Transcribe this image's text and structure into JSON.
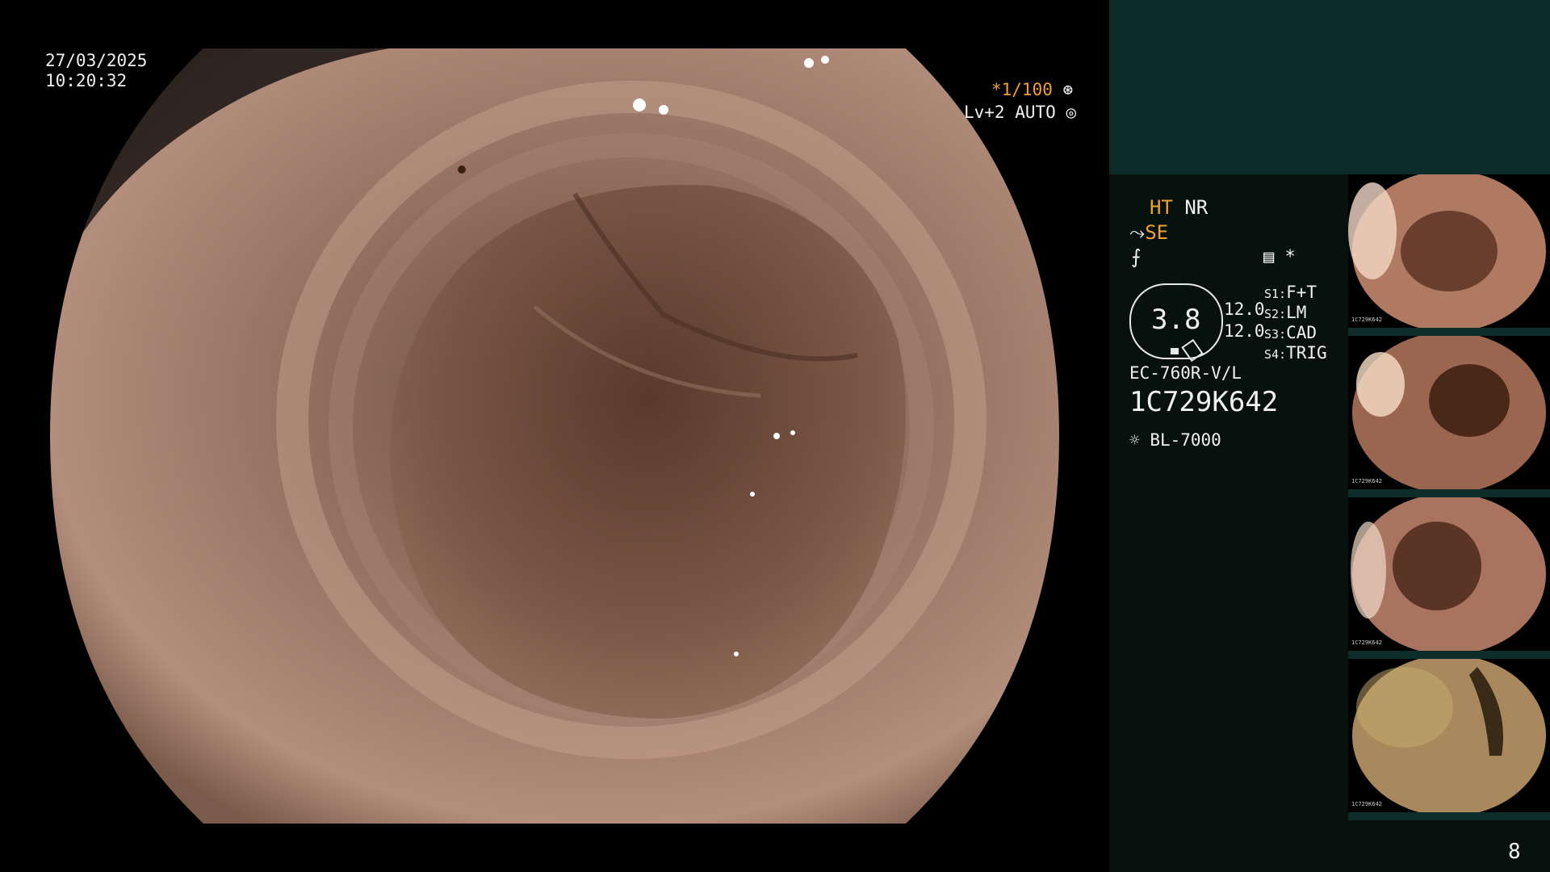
{
  "overlay": {
    "date": "27/03/2025",
    "time": "10:20:32",
    "shutter": "*1/100",
    "level_mode": "Lv+2 AUTO"
  },
  "settings": {
    "ht": "HT",
    "nr": "NR",
    "se": "SE",
    "asterisk": "*",
    "gauge_value": "3.8",
    "val_top": "12.0",
    "val_bottom": "12.0",
    "s1_label": "S1:",
    "s1_value": "F+T",
    "s2_label": "S2:",
    "s2_value": "LM",
    "s3_label": "S3:",
    "s3_value": "CAD",
    "s4_label": "S4:",
    "s4_value": "TRIG"
  },
  "device": {
    "scope_model": "EC-760R-V/L",
    "serial": "1C729K642",
    "light_source": "BL-7000"
  },
  "thumbnails": [
    {
      "id_text": "1C729K642"
    },
    {
      "id_text": "1C729K642"
    },
    {
      "id_text": "1C729K642"
    },
    {
      "id_text": "1C729K642"
    }
  ],
  "page_number": "8",
  "colors": {
    "accent_orange": "#f0a030",
    "panel_top": "#0c2a26",
    "panel_bottom": "#07120f",
    "tissue": "#8a6a5a"
  }
}
